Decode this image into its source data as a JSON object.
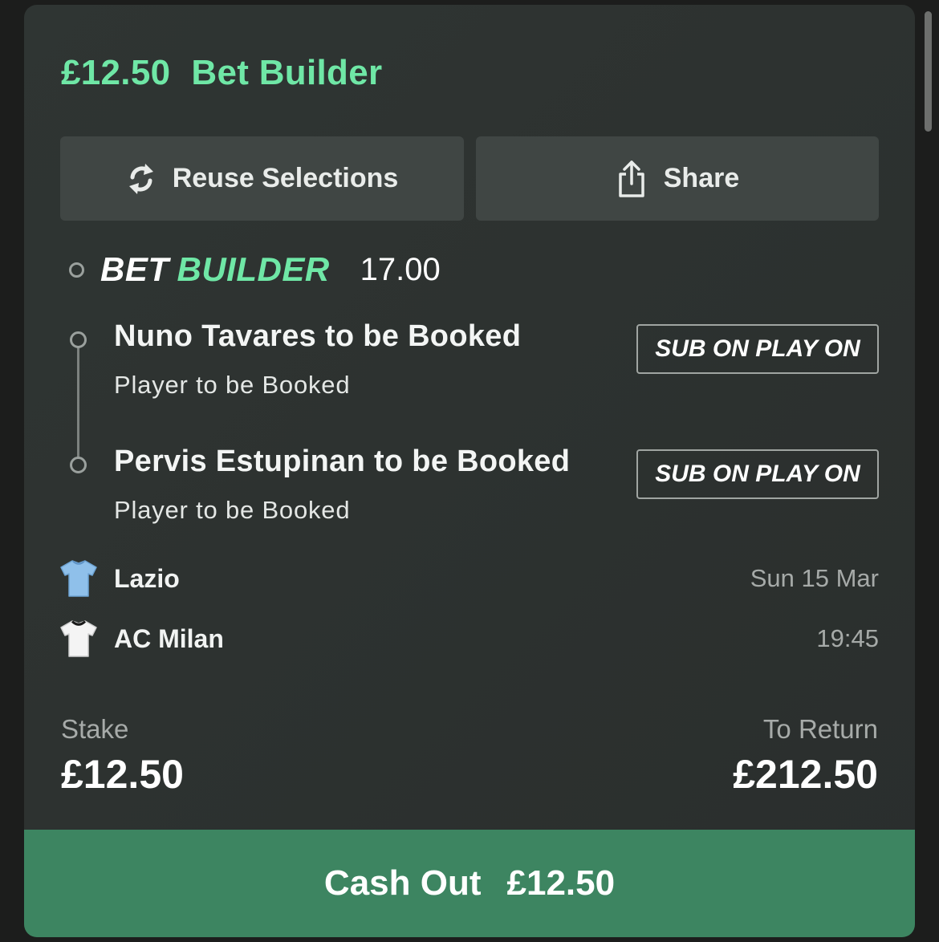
{
  "bet": {
    "stake_header": "£12.50",
    "type_header": "Bet Builder"
  },
  "actions": {
    "reuse_label": "Reuse Selections",
    "share_label": "Share"
  },
  "bet_builder": {
    "logo_word1": "BET",
    "logo_word2": "BUILDER",
    "odds": "17.00"
  },
  "selections": [
    {
      "title": "Nuno Tavares to be Booked",
      "market": "Player to be Booked",
      "badge": "SUB ON PLAY ON"
    },
    {
      "title": "Pervis Estupinan to be Booked",
      "market": "Player to be Booked",
      "badge": "SUB ON PLAY ON"
    }
  ],
  "match": {
    "home_team": "Lazio",
    "away_team": "AC Milan",
    "date": "Sun 15 Mar",
    "time": "19:45",
    "home_shirt_icon": "sky-blue-shirt",
    "away_shirt_icon": "white-shirt"
  },
  "summary": {
    "stake_label": "Stake",
    "stake_value": "£12.50",
    "return_label": "To Return",
    "return_value": "£212.50"
  },
  "cashout": {
    "label": "Cash Out",
    "amount": "£12.50"
  },
  "colors": {
    "accent_green": "#6fe7a6",
    "cashout_green": "#3d8561",
    "card_bg": "#2f3533"
  }
}
